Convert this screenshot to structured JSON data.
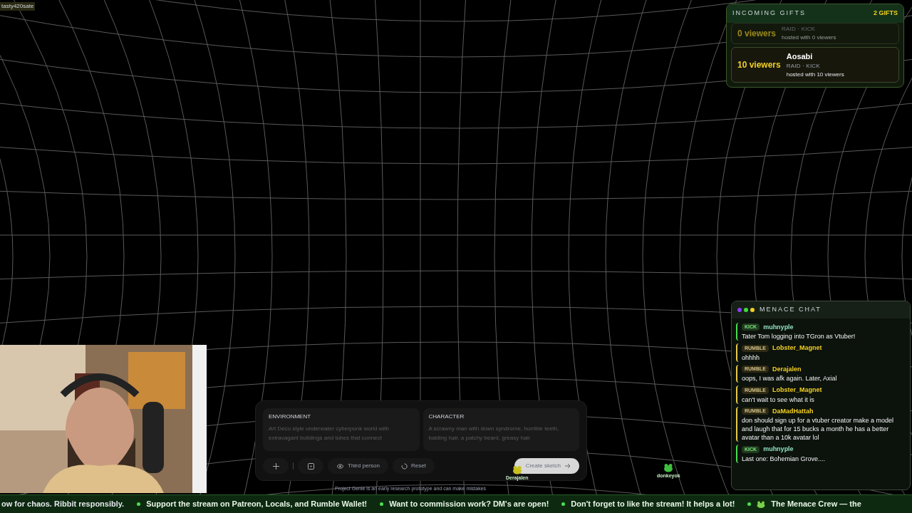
{
  "streamer_tag": "tasty420sate",
  "gifts": {
    "title": "INCOMING GIFTS",
    "count": "2 GIFTS",
    "items": [
      {
        "faded": true,
        "amount": "0 viewers",
        "source": "RAID · KICK",
        "detail": "hosted with 0 viewers"
      },
      {
        "faded": false,
        "name": "Aosabi",
        "amount": "10 viewers",
        "source": "RAID · KICK",
        "detail": "hosted with 10 viewers"
      }
    ]
  },
  "chat": {
    "dots": [
      {
        "color": "#8b3dff"
      },
      {
        "color": "#3ddc3d"
      },
      {
        "color": "#f2d024"
      }
    ],
    "title": "MENACE CHAT",
    "messages": [
      {
        "kind": "kick",
        "badge": "KICK",
        "user": "muhnyple",
        "text": "Tater Tom logging into TGron as Vtuber!"
      },
      {
        "kind": "rumble",
        "badge": "RUMBLE",
        "user": "Lobster_Magnet",
        "text": "ohhhh"
      },
      {
        "kind": "rumble",
        "badge": "RUMBLE",
        "user": "Derajalen",
        "text": "oops, I was afk again. Later, Axial"
      },
      {
        "kind": "rumble",
        "badge": "RUMBLE",
        "user": "Lobster_Magnet",
        "text": "can't wait to see what it is"
      },
      {
        "kind": "rumble",
        "badge": "RUMBLE",
        "user": "DaMadHattah",
        "text": "don should sign up for a vtuber creator make a model and laugh that for 15 bucks a month he has a better avatar than a 10k avatar lol"
      },
      {
        "kind": "kick",
        "badge": "KICK",
        "user": "muhnyple",
        "text": "Last one: Bohemian Grove...."
      }
    ]
  },
  "prompt_panel": {
    "fields": [
      {
        "label": "ENVIRONMENT",
        "placeholder": "Art Deco style underwater cyberpunk world with extravagant buildings and tubes that connect"
      },
      {
        "label": "CHARACTER",
        "placeholder": "A scrawny man with down syndrome, horrible teeth, balding hair, a patchy beard, greasy hair"
      }
    ],
    "buttons": [
      {
        "kind": "add"
      },
      {
        "kind": "frame"
      },
      {
        "kind": "view",
        "label": "Third person"
      },
      {
        "kind": "reset",
        "label": "Reset"
      }
    ],
    "create_button": "Create sketch",
    "disclaimer": "Project Genie is an early research prototype and can make mistakes"
  },
  "viewers": [
    {
      "name": "Derajalen"
    },
    {
      "name": "donkeyok"
    }
  ],
  "ticker": [
    {
      "kind": "partial",
      "text": "ow for chaos. Ribbit responsibly."
    },
    {
      "kind": "dot",
      "text": "Support the stream on Patreon, Locals, and Rumble Wallet!"
    },
    {
      "kind": "dot",
      "text": "Want to commission work? DM's are open!"
    },
    {
      "kind": "dot",
      "text": "Don't forget to like the stream! It helps a lot!"
    },
    {
      "kind": "frog",
      "text": "The Menace Crew — the"
    }
  ]
}
